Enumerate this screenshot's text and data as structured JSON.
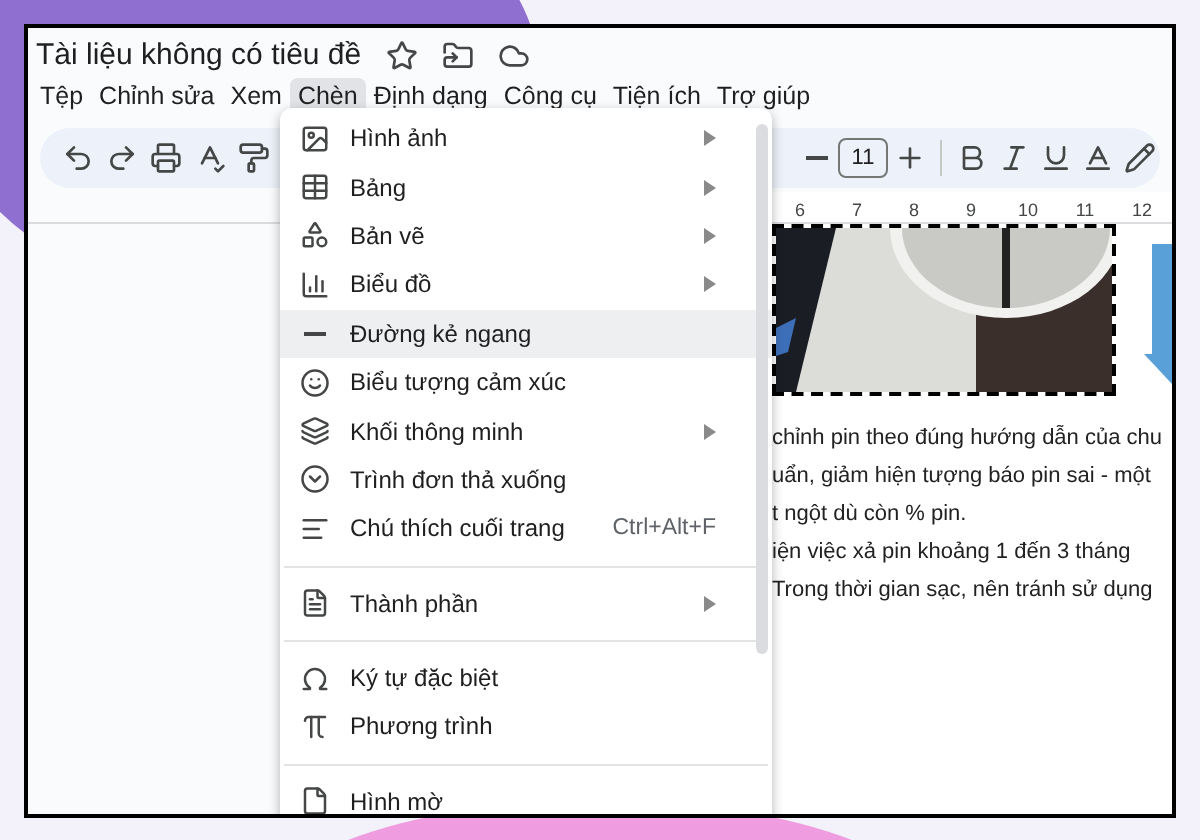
{
  "document": {
    "title": "Tài liệu không có tiêu đề"
  },
  "menu_bar": [
    {
      "label": "Tệp",
      "selected": false
    },
    {
      "label": "Chỉnh sửa",
      "selected": false
    },
    {
      "label": "Xem",
      "selected": false
    },
    {
      "label": "Chèn",
      "selected": true
    },
    {
      "label": "Định dạng",
      "selected": false
    },
    {
      "label": "Công cụ",
      "selected": false
    },
    {
      "label": "Tiện ích",
      "selected": false
    },
    {
      "label": "Trợ giúp",
      "selected": false
    }
  ],
  "toolbar": {
    "font_size": "11"
  },
  "ruler": [
    "6",
    "7",
    "8",
    "9",
    "10",
    "11",
    "12"
  ],
  "insert_menu": [
    {
      "kind": "item",
      "label": "Hình ảnh",
      "submenu": true,
      "highlighted": false
    },
    {
      "kind": "item",
      "label": "Bảng",
      "submenu": true,
      "highlighted": false
    },
    {
      "kind": "item",
      "label": "Bản vẽ",
      "submenu": true,
      "highlighted": false
    },
    {
      "kind": "item",
      "label": "Biểu đồ",
      "submenu": true,
      "highlighted": false
    },
    {
      "kind": "item",
      "label": "Đường kẻ ngang",
      "submenu": false,
      "highlighted": true
    },
    {
      "kind": "item",
      "label": "Biểu tượng cảm xúc",
      "submenu": false,
      "highlighted": false
    },
    {
      "kind": "item",
      "label": "Khối thông minh",
      "submenu": true,
      "highlighted": false
    },
    {
      "kind": "item",
      "label": "Trình đơn thả xuống",
      "submenu": false,
      "highlighted": false
    },
    {
      "kind": "item",
      "label": "Chú thích cuối trang",
      "shortcut": "Ctrl+Alt+F",
      "submenu": false,
      "highlighted": false
    },
    {
      "kind": "divider"
    },
    {
      "kind": "item",
      "label": "Thành phần",
      "submenu": true,
      "highlighted": false
    },
    {
      "kind": "divider"
    },
    {
      "kind": "item",
      "label": "Ký tự đặc biệt",
      "submenu": false,
      "highlighted": false
    },
    {
      "kind": "item",
      "label": "Phương trình",
      "submenu": false,
      "highlighted": false
    },
    {
      "kind": "divider"
    },
    {
      "kind": "item",
      "label": "Hình mờ",
      "submenu": false,
      "highlighted": false
    }
  ],
  "body_text": [
    "chỉnh pin theo đúng hướng dẫn của chu",
    "uẩn, giảm hiện tượng báo pin sai - một",
    "t ngột dù còn % pin.",
    "iện việc xả pin khoảng 1 đến 3 tháng",
    "Trong thời gian sạc, nên tránh sử dụng"
  ]
}
